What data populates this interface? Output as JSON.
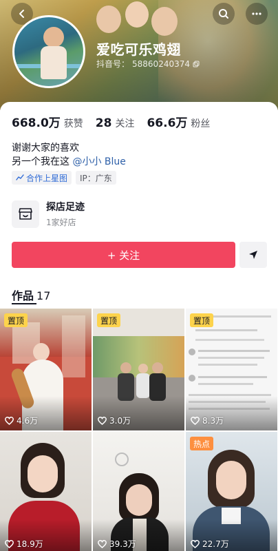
{
  "profile": {
    "name": "爱吃可乐鸡翅",
    "uid_label": "抖音号：",
    "uid": "58860240374"
  },
  "stats": [
    {
      "value": "668.0万",
      "label": "获赞"
    },
    {
      "value": "28",
      "label": "关注"
    },
    {
      "value": "66.6万",
      "label": "粉丝"
    }
  ],
  "bio": {
    "line1": "谢谢大家的喜欢",
    "line2_prefix": "另一个我在这 ",
    "mention": "@小小 Blue"
  },
  "tags": {
    "cooperation": "合作上星图",
    "ip": "IP：广东"
  },
  "store": {
    "title": "探店足迹",
    "subtitle": "1家好店"
  },
  "actions": {
    "follow": "+ 关注"
  },
  "works": {
    "label": "作品",
    "count": "17"
  },
  "videos": [
    {
      "badge": "置顶",
      "likes": "4.6万"
    },
    {
      "badge": "置顶",
      "likes": "3.0万"
    },
    {
      "badge": "置顶",
      "likes": "8.3万"
    },
    {
      "badge": "",
      "likes": "18.9万"
    },
    {
      "badge": "",
      "likes": "39.3万"
    },
    {
      "badge": "热点",
      "likes": "22.7万"
    }
  ],
  "icons": {
    "back": "chevron-left-icon",
    "search": "search-icon",
    "more": "more-icon",
    "copy": "copy-icon",
    "share": "share-icon",
    "heart": "heart-icon",
    "store": "store-icon"
  },
  "colors": {
    "follow_button": "#f2455f",
    "pin_badge": "#fdd34c",
    "hot_badge": "#fd8f3f",
    "mention": "#2d5fa8"
  }
}
